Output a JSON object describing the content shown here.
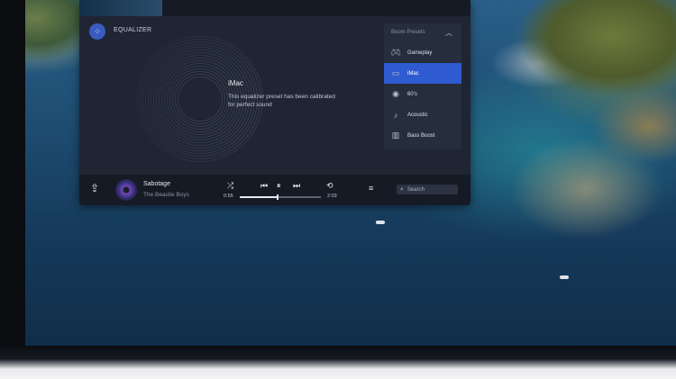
{
  "equalizer": {
    "title": "EQUALIZER",
    "preset_name": "iMac",
    "preset_description": "This equalizer preset has been calibrated for perfect sound"
  },
  "presets": {
    "header": "Boom Presets",
    "items": [
      {
        "label": "Gameplay",
        "icon": "gamepad-icon",
        "active": false
      },
      {
        "label": "iMac",
        "icon": "monitor-icon",
        "active": true
      },
      {
        "label": "60's",
        "icon": "vinyl-icon",
        "active": false
      },
      {
        "label": "Acoustic",
        "icon": "guitar-icon",
        "active": false
      },
      {
        "label": "Bass Boost",
        "icon": "speaker-icon",
        "active": false
      }
    ]
  },
  "player": {
    "song": "Sabotage",
    "artist": "The Beastie Boys",
    "elapsed": "0:55",
    "duration": "2:03",
    "progress_fraction": 0.45
  },
  "search": {
    "placeholder": "Search"
  },
  "colors": {
    "accent": "#2f5bd0",
    "panel": "#1f2533",
    "player_bar": "#151a24"
  }
}
